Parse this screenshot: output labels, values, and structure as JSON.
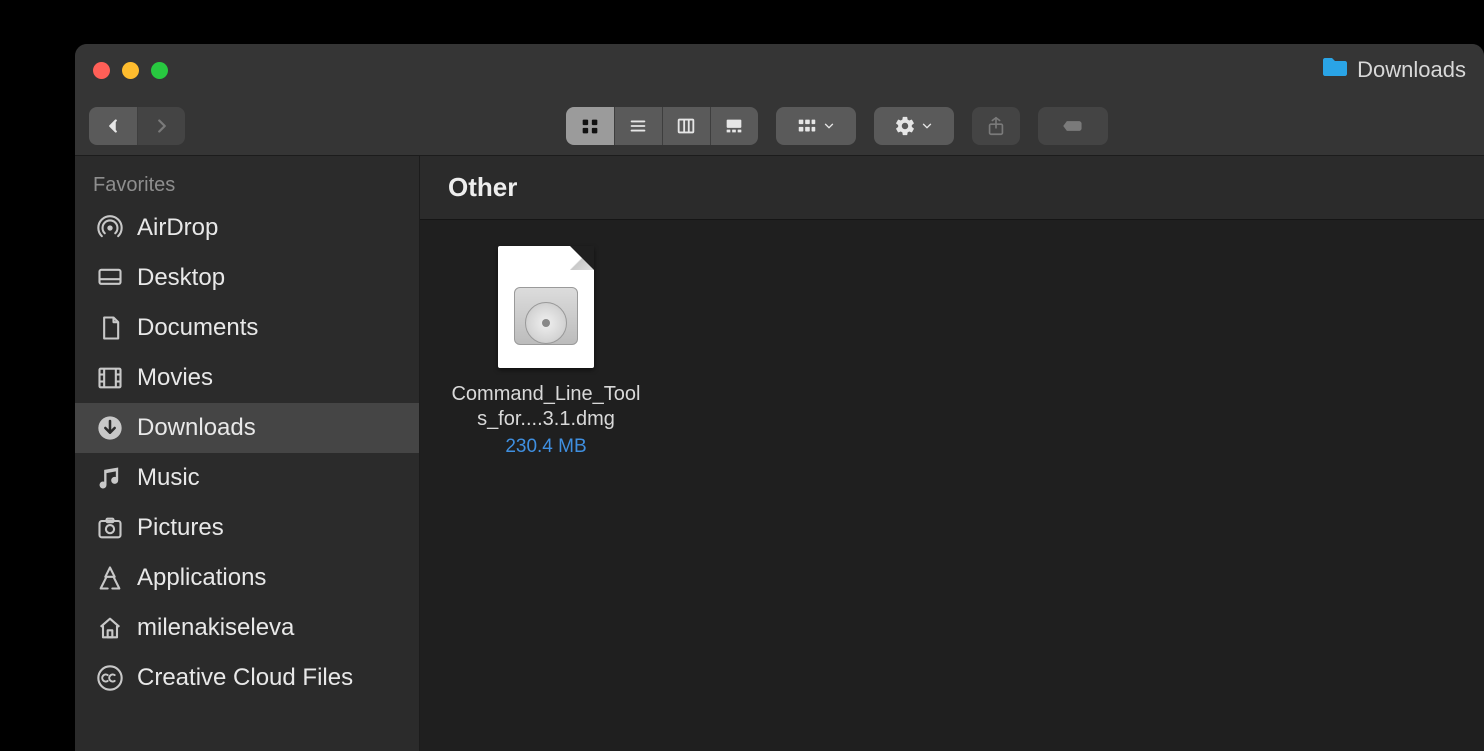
{
  "window": {
    "title": "Downloads"
  },
  "sidebar": {
    "heading": "Favorites",
    "items": [
      {
        "id": "airdrop",
        "label": "AirDrop",
        "icon": "airdrop",
        "selected": false
      },
      {
        "id": "desktop",
        "label": "Desktop",
        "icon": "desktop",
        "selected": false
      },
      {
        "id": "documents",
        "label": "Documents",
        "icon": "document",
        "selected": false
      },
      {
        "id": "movies",
        "label": "Movies",
        "icon": "movies",
        "selected": false
      },
      {
        "id": "downloads",
        "label": "Downloads",
        "icon": "download",
        "selected": true
      },
      {
        "id": "music",
        "label": "Music",
        "icon": "music",
        "selected": false
      },
      {
        "id": "pictures",
        "label": "Pictures",
        "icon": "pictures",
        "selected": false
      },
      {
        "id": "applications",
        "label": "Applications",
        "icon": "apps",
        "selected": false
      },
      {
        "id": "home",
        "label": "milenakiseleva",
        "icon": "home",
        "selected": false
      },
      {
        "id": "ccloud",
        "label": "Creative Cloud Files",
        "icon": "cc",
        "selected": false
      }
    ]
  },
  "content": {
    "section_title": "Other",
    "files": [
      {
        "name": "Command_Line_Tools_for....3.1.dmg",
        "size": "230.4 MB",
        "kind": "dmg"
      }
    ]
  }
}
